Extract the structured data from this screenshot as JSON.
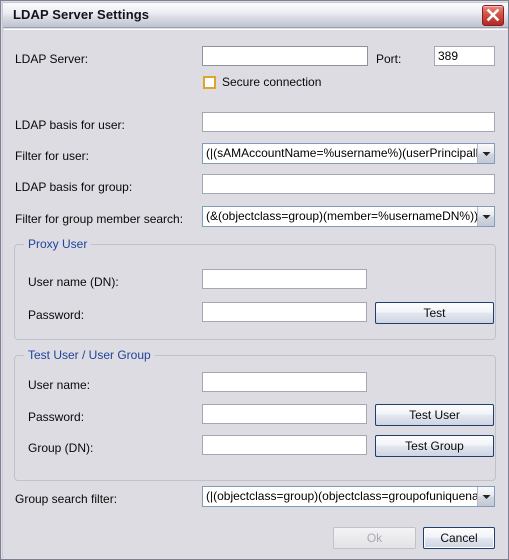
{
  "window": {
    "title": "LDAP Server Settings",
    "close_icon": "close-icon"
  },
  "server_section": {
    "ldap_server_label": "LDAP Server:",
    "ldap_server_value": "",
    "ldap_server_placeholder": "",
    "port_label": "Port:",
    "port_value": "389",
    "secure_connection_label": "Secure connection",
    "secure_connection_checked": false
  },
  "ldap_fields": {
    "basis_user_label": "LDAP basis for user:",
    "basis_user_value": "",
    "filter_user_label": "Filter for user:",
    "filter_user_value": "(|(sAMAccountName=%username%)(userPrincipalName=%",
    "basis_group_label": "LDAP basis for group:",
    "basis_group_value": "",
    "filter_group_member_label": "Filter for group member search:",
    "filter_group_member_value": "(&(objectclass=group)(member=%usernameDN%))"
  },
  "proxy_user": {
    "legend": "Proxy User",
    "username_label": "User name (DN):",
    "username_value": "",
    "password_label": "Password:",
    "password_value": "",
    "test_button": "Test"
  },
  "test_user": {
    "legend": "Test User / User Group",
    "username_label": "User name:",
    "username_value": "",
    "password_label": "Password:",
    "password_value": "",
    "group_dn_label": "Group (DN):",
    "group_dn_value": "",
    "test_user_button": "Test User",
    "test_group_button": "Test Group"
  },
  "group_search": {
    "label": "Group search filter:",
    "value": "(|(objectclass=group)(objectclass=groupofuniquenames))"
  },
  "dialog_buttons": {
    "ok_label": "Ok",
    "ok_enabled": false,
    "cancel_label": "Cancel",
    "cancel_enabled": true
  },
  "colors": {
    "dialog_background": "#dcdce2",
    "legend_blue": "#21439c",
    "button_border": "#1f3f6e",
    "close_red": "#c23a30",
    "checkbox_amber": "#e0a42a"
  }
}
